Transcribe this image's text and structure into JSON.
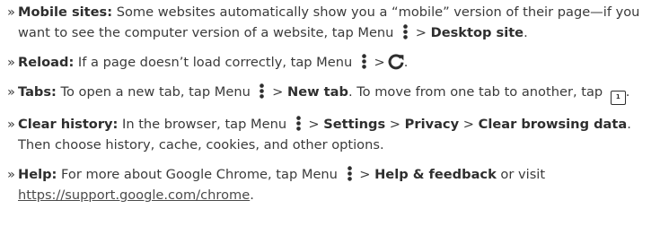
{
  "bullet_glyph": "»",
  "sep": ">",
  "items": [
    {
      "title": "Mobile sites:",
      "text1": " Some websites automatically show you a “mobile” version of their page—if you want to see the computer version of a website, tap Menu ",
      "bold1": "Desktop site",
      "text2": "."
    },
    {
      "title": "Reload:",
      "text1": " If a page doesn’t load correctly, tap Menu ",
      "text2": "."
    },
    {
      "title": "Tabs:",
      "text1": " To open a new tab, tap Menu ",
      "bold1": "New tab",
      "text2": ". To move from one tab to another, tap ",
      "tab_count": "1",
      "text3": "."
    },
    {
      "title": "Clear history:",
      "text1": " In the browser, tap Menu ",
      "bold1": "Settings",
      "bold2": "Privacy",
      "bold3": "Clear browsing data",
      "text2": ". Then choose history, cache, cookies, and other options."
    },
    {
      "title": "Help:",
      "text1": " For more about Google Chrome, tap Menu ",
      "bold1": "Help & feedback",
      "text2": " or visit ",
      "link": "https://support.google.com/chrome",
      "text3": "."
    }
  ],
  "icons": {
    "menu": "menu-icon",
    "reload": "reload-icon",
    "tab": "tab-switcher-icon"
  },
  "colors": {
    "text": "#3a3a3a",
    "bold": "#2e2e2e",
    "icon": "#2e2e2e"
  }
}
